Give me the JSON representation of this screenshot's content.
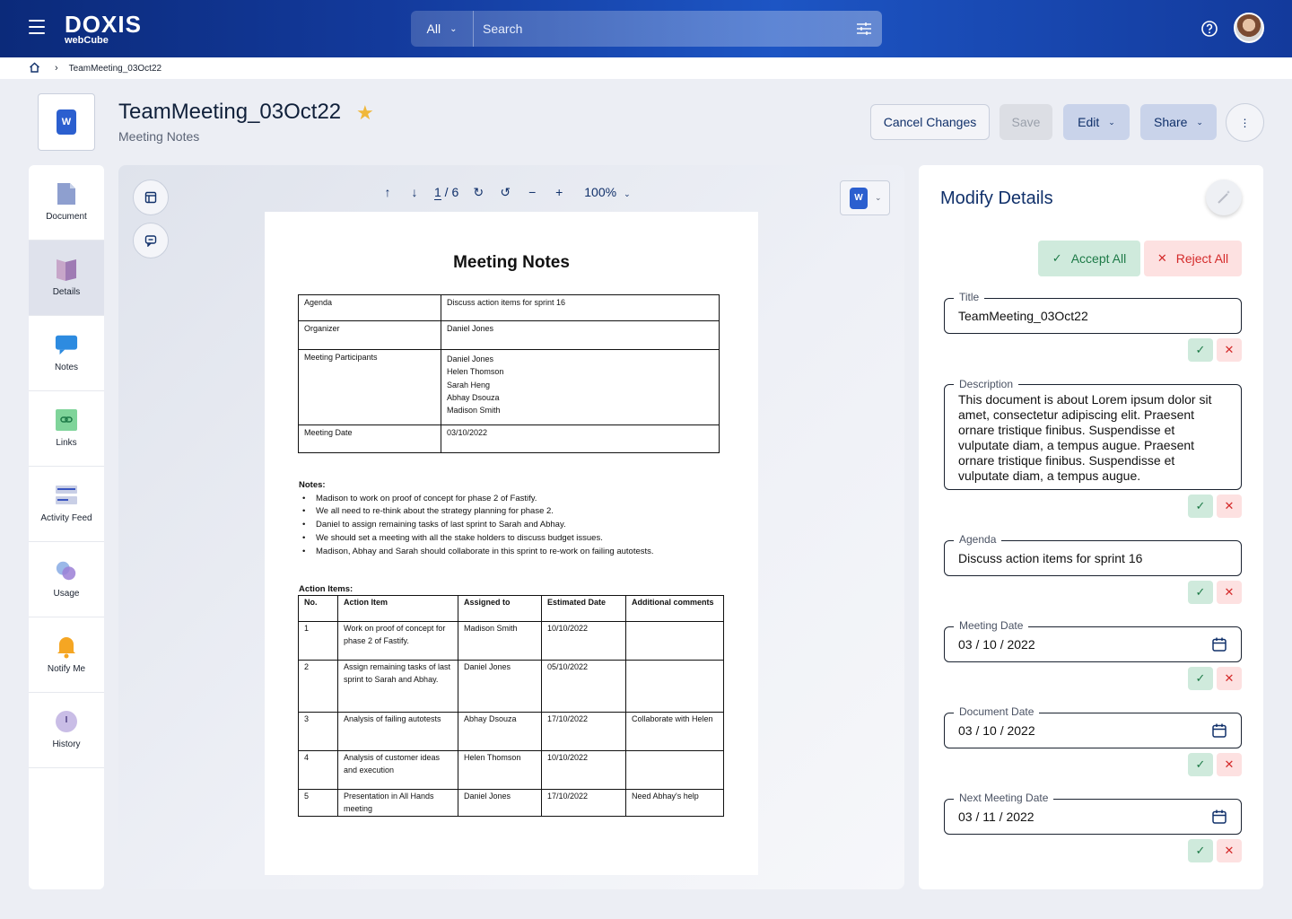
{
  "topbar": {
    "logo_main": "DOXIS",
    "logo_sub": "webCube",
    "search_scope": "All",
    "search_placeholder": "Search"
  },
  "breadcrumb": {
    "current": "TeamMeeting_03Oct22"
  },
  "document": {
    "title": "TeamMeeting_03Oct22",
    "type_label": "Meeting Notes",
    "format_badge": "W"
  },
  "actions": {
    "cancel": "Cancel Changes",
    "save": "Save",
    "edit": "Edit",
    "share": "Share",
    "more": "⋮"
  },
  "sidebar": {
    "items": [
      {
        "label": "Document",
        "icon": "document-icon"
      },
      {
        "label": "Details",
        "icon": "details-icon"
      },
      {
        "label": "Notes",
        "icon": "notes-icon"
      },
      {
        "label": "Links",
        "icon": "links-icon"
      },
      {
        "label": "Activity Feed",
        "icon": "activity-feed-icon"
      },
      {
        "label": "Usage",
        "icon": "usage-icon"
      },
      {
        "label": "Notify Me",
        "icon": "bell-icon"
      },
      {
        "label": "History",
        "icon": "history-icon"
      }
    ],
    "active": "Details"
  },
  "viewer": {
    "page_current": "1",
    "page_total": "6",
    "zoom": "100%"
  },
  "doc_page": {
    "heading": "Meeting Notes",
    "info": [
      {
        "label": "Agenda",
        "value": "Discuss action items for sprint 16"
      },
      {
        "label": "Organizer",
        "value": "Daniel Jones"
      },
      {
        "label": "Meeting Participants",
        "value": "Daniel Jones\nHelen Thomson\nSarah Heng\nAbhay Dsouza\nMadison Smith"
      },
      {
        "label": "Meeting Date",
        "value": "03/10/2022"
      }
    ],
    "notes_title": "Notes:",
    "notes": [
      "Madison to work on proof of concept for phase 2 of Fastify.",
      "We all need to re-think about the strategy planning for phase 2.",
      "Daniel to assign remaining tasks of last sprint to Sarah and Abhay.",
      "We should set a meeting with all the stake holders to discuss budget issues.",
      "Madison, Abhay and Sarah should collaborate in this sprint to re-work on failing autotests."
    ],
    "action_items_title": "Action Items:",
    "action_headers": [
      "No.",
      "Action Item",
      "Assigned to",
      "Estimated Date",
      "Additional comments"
    ],
    "action_rows": [
      [
        "1",
        "Work on proof of concept for phase 2 of Fastify.",
        "Madison Smith",
        "10/10/2022",
        ""
      ],
      [
        "2",
        "Assign remaining tasks of last sprint to Sarah and Abhay.",
        "Daniel Jones",
        "05/10/2022",
        ""
      ],
      [
        "3",
        "Analysis of failing autotests",
        "Abhay Dsouza",
        "17/10/2022",
        "Collaborate with Helen"
      ],
      [
        "4",
        "Analysis of customer ideas and execution",
        "Helen Thomson",
        "10/10/2022",
        ""
      ],
      [
        "5",
        "Presentation in All Hands meeting",
        "Daniel Jones",
        "17/10/2022",
        "Need Abhay's help"
      ]
    ]
  },
  "panel": {
    "title": "Modify Details",
    "accept_all": "Accept All",
    "reject_all": "Reject All",
    "fields": [
      {
        "label": "Title",
        "value": "TeamMeeting_03Oct22"
      },
      {
        "label": "Description",
        "value": "This document is about Lorem ipsum dolor sit amet, consectetur adipiscing elit. Praesent ornare tristique finibus. Suspendisse et vulputate diam, a tempus augue.  Praesent ornare tristique finibus. Suspendisse et vulputate diam, a tempus augue."
      },
      {
        "label": "Agenda",
        "value": "Discuss action items for sprint 16"
      },
      {
        "label": "Meeting Date",
        "value": "03 / 10 / 2022"
      },
      {
        "label": "Document Date",
        "value": "03 / 10 / 2022"
      },
      {
        "label": "Next Meeting Date",
        "value": "03 / 11 / 2022"
      }
    ]
  },
  "colors": {
    "brand_blue": "#133a9c",
    "accept_bg": "#cfeadc",
    "reject_bg": "#fde1e1",
    "accent_star": "#f0b73a"
  }
}
